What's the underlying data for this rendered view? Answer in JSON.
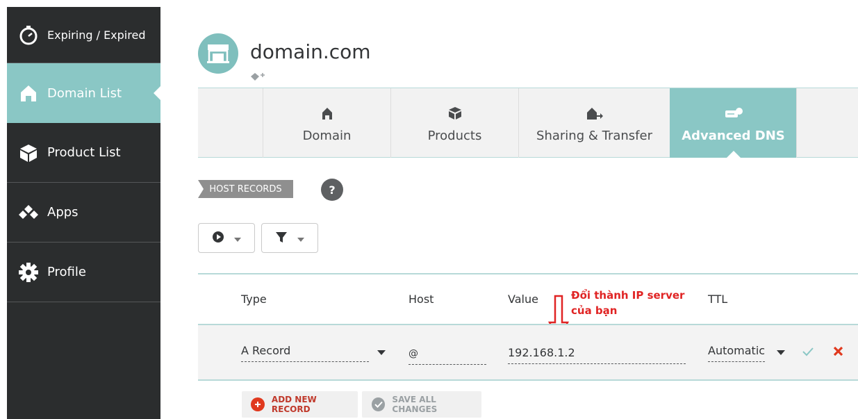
{
  "sidebar": {
    "items": [
      {
        "label": "Expiring / Expired",
        "icon": "stopwatch-icon"
      },
      {
        "label": "Domain List",
        "icon": "house-icon",
        "active": true
      },
      {
        "label": "Product List",
        "icon": "box-icon"
      },
      {
        "label": "Apps",
        "icon": "apps-icon"
      },
      {
        "label": "Profile",
        "icon": "gear-icon"
      }
    ]
  },
  "header": {
    "domain": "domain.com",
    "avatar_icon": "storefront-icon",
    "tag_icon": "tag-add-icon"
  },
  "tabs": [
    {
      "label": "Domain",
      "icon": "house-icon"
    },
    {
      "label": "Products",
      "icon": "box-icon"
    },
    {
      "label": "Sharing & Transfer",
      "icon": "house-arrow-icon"
    },
    {
      "label": "Advanced DNS",
      "icon": "server-icon",
      "active": true
    }
  ],
  "section": {
    "label": "HOST RECORDS",
    "help": "?"
  },
  "filters": {
    "action_icon": "play-circle-icon",
    "filter_icon": "funnel-icon"
  },
  "table": {
    "headers": {
      "type": "Type",
      "host": "Host",
      "value": "Value",
      "ttl": "TTL"
    },
    "row": {
      "type": "A Record",
      "host": "@",
      "value": "192.168.1.2",
      "ttl": "Automatic"
    }
  },
  "annotation": {
    "line1": "Đổi thành IP server",
    "line2": "của bạn"
  },
  "actions": {
    "add_label": "ADD NEW RECORD",
    "save_label": "SAVE ALL CHANGES"
  },
  "colors": {
    "accent": "#8ac7c5",
    "sidebar": "#2b2d2e",
    "danger": "#e02424"
  }
}
